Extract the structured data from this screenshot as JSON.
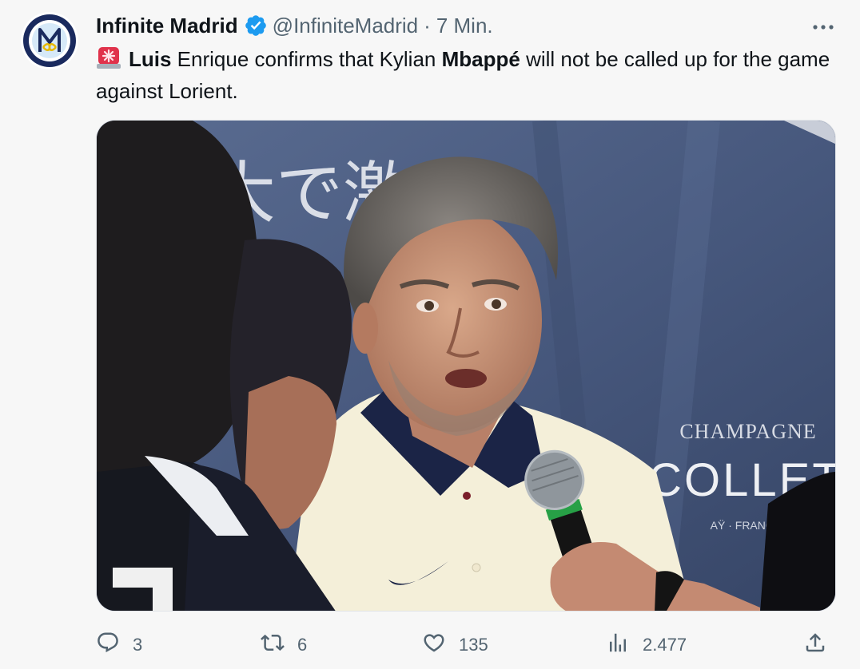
{
  "tweet": {
    "author_name": "Infinite Madrid",
    "handle": "@InfiniteMadrid",
    "separator": "·",
    "time": "7 Min.",
    "text_bold_1": "Luis",
    "text_1": " Enrique confirms that Kylian ",
    "text_bold_2": "Mbappé",
    "text_2": " will not be called up for the game against Lorient.",
    "media": {
      "sign_text_jp": "大で激",
      "brand_line_1": "CHAMPAGNE",
      "brand_line_2": "COLLET",
      "brand_line_3": "AŸ · FRANCE"
    }
  },
  "actions": {
    "replies": "3",
    "retweets": "6",
    "likes": "135",
    "views": "2.477"
  },
  "icons": {
    "verified": "verified-badge-icon",
    "more": "more-icon",
    "reply": "reply-icon",
    "retweet": "retweet-icon",
    "like": "like-icon",
    "views": "views-icon",
    "share": "share-icon",
    "siren": "siren-emoji-icon"
  },
  "colors": {
    "text": "#0f1419",
    "secondary": "#536471",
    "verified": "#1d9bf0",
    "background": "#f7f7f7"
  }
}
